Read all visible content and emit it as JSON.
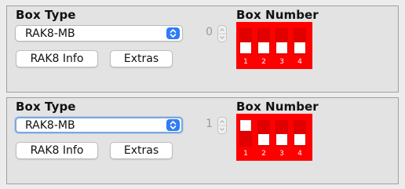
{
  "panels": [
    {
      "box_type_heading": "Box Type",
      "box_number_heading": "Box Number",
      "box_type_value": "RAK8-MB",
      "box_number_value": "0",
      "info_button": "RAK8 Info",
      "extras_button": "Extras",
      "switches": [
        {
          "label": "1",
          "state": "down"
        },
        {
          "label": "2",
          "state": "down"
        },
        {
          "label": "3",
          "state": "down"
        },
        {
          "label": "4",
          "state": "down"
        }
      ]
    },
    {
      "box_type_heading": "Box Type",
      "box_number_heading": "Box Number",
      "box_type_value": "RAK8-MB",
      "box_number_value": "1",
      "info_button": "RAK8 Info",
      "extras_button": "Extras",
      "switches": [
        {
          "label": "1",
          "state": "up"
        },
        {
          "label": "2",
          "state": "down"
        },
        {
          "label": "3",
          "state": "down"
        },
        {
          "label": "4",
          "state": "down"
        }
      ]
    }
  ],
  "colors": {
    "dip_background": "#ff0000",
    "dip_slot": "#e00000",
    "select_arrow": "#2f7cf6",
    "focus_ring": "#7fa7d8"
  },
  "icons": {
    "select_arrow": "updown-chevron-icon",
    "stepper": "stepper-arrows-icon"
  }
}
